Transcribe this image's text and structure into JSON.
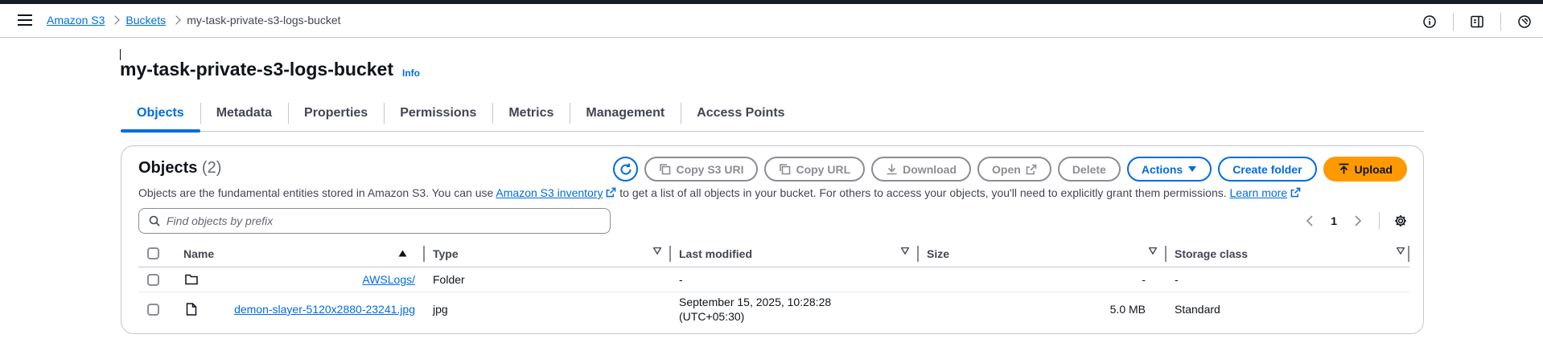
{
  "breadcrumb": {
    "items": [
      "Amazon S3",
      "Buckets"
    ],
    "current": "my-task-private-s3-logs-bucket"
  },
  "page": {
    "title": "my-task-private-s3-logs-bucket",
    "info": "Info"
  },
  "tabs": [
    "Objects",
    "Metadata",
    "Properties",
    "Permissions",
    "Metrics",
    "Management",
    "Access Points"
  ],
  "objects": {
    "heading": "Objects",
    "count": "(2)",
    "buttons": {
      "copy_s3_uri": "Copy S3 URI",
      "copy_url": "Copy URL",
      "download": "Download",
      "open": "Open",
      "delete": "Delete",
      "actions": "Actions",
      "create_folder": "Create folder",
      "upload": "Upload"
    },
    "description": {
      "part1": "Objects are the fundamental entities stored in Amazon S3. You can use ",
      "link1": "Amazon S3 inventory",
      "part2": " to get a list of all objects in your bucket. For others to access your objects, you'll need to explicitly grant them permissions. ",
      "link2": "Learn more"
    },
    "search_placeholder": "Find objects by prefix",
    "page_number": "1",
    "columns": [
      "Name",
      "Type",
      "Last modified",
      "Size",
      "Storage class"
    ],
    "rows": [
      {
        "name": "AWSLogs/",
        "icon": "folder-icon",
        "type": "Folder",
        "last_modified": "-",
        "size": "-",
        "storage_class": "-"
      },
      {
        "name": "demon-slayer-5120x2880-23241.jpg",
        "icon": "file-icon",
        "type": "jpg",
        "last_modified_line1": "September 15, 2025, 10:28:28",
        "last_modified_line2": "(UTC+05:30)",
        "size": "5.0 MB",
        "storage_class": "Standard"
      }
    ]
  },
  "colors": {
    "accent": "#006ce0",
    "primary_button": "#ff9900",
    "disabled": "#8c8c94"
  }
}
